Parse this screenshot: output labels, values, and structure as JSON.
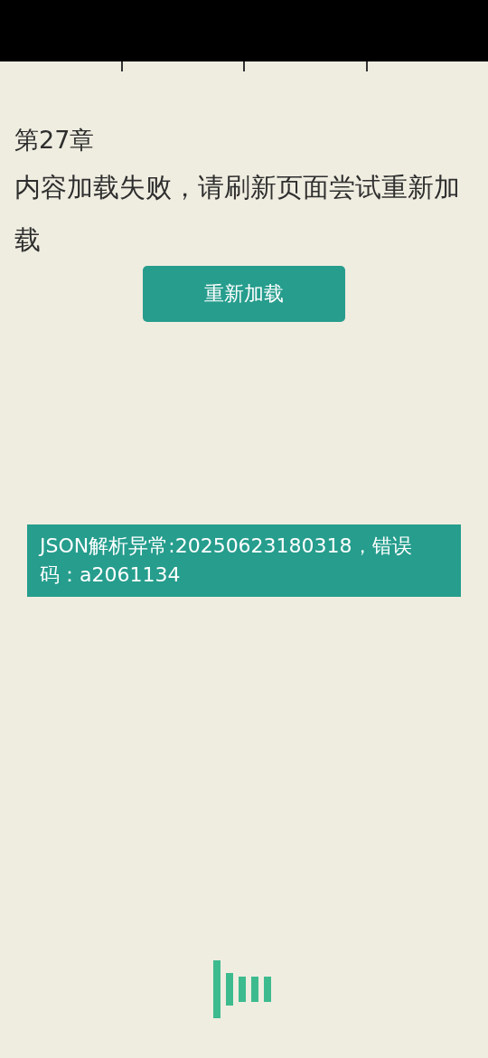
{
  "chapter_title": "第27章",
  "error_message": "内容加载失败，请刷新页面尝试重新加载",
  "reload_button": "重新加载",
  "error_banner": "JSON解析异常:20250623180318，错误码：a2061134"
}
